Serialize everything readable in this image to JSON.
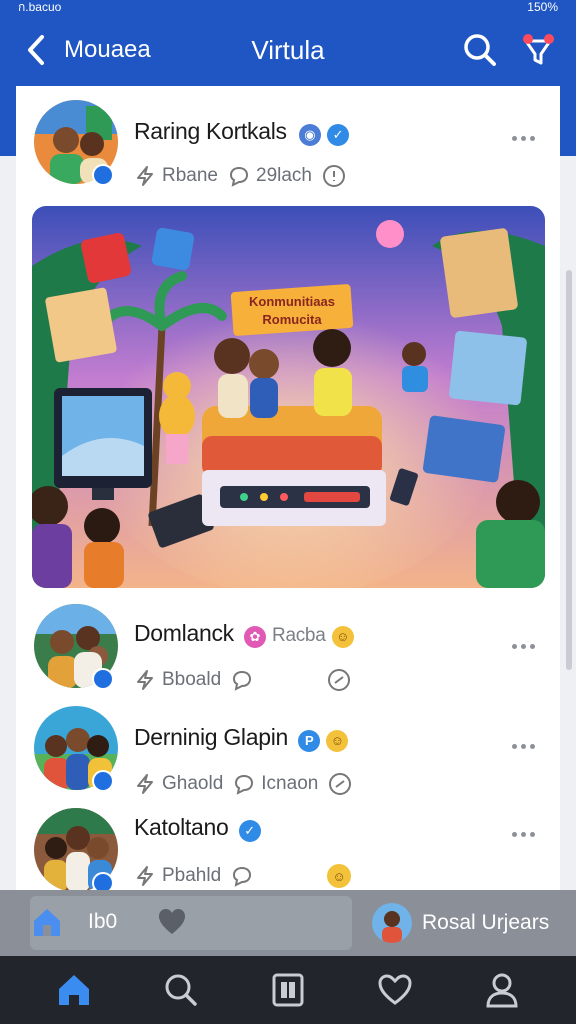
{
  "status_bar": {
    "left": "ก.bacuo",
    "right": "150%"
  },
  "top_bar": {
    "back_label": "Mouaea",
    "title": "Virtula",
    "accent": "#1f56c3"
  },
  "posts": [
    {
      "name": "Raring Kortkals",
      "meta": [
        "Rbane",
        "29lach"
      ],
      "avatar_colors": [
        "#e6733a",
        "#3f8fd8"
      ]
    },
    {
      "name": "Domlanck",
      "tag": "Racba",
      "meta": [
        "Bboald"
      ],
      "avatar_colors": [
        "#3b7d4a",
        "#e3a13a"
      ]
    },
    {
      "name": "Derninig Glapin",
      "meta": [
        "Ghaold",
        "Icnaon"
      ],
      "avatar_colors": [
        "#3aa6d8",
        "#e0543b"
      ]
    },
    {
      "name": "Katoltano",
      "meta": [
        "Pbahld"
      ],
      "avatar_colors": [
        "#8b5a3c",
        "#e2b23a"
      ]
    }
  ],
  "hero": {
    "banner_line1": "Konmunitiaas",
    "banner_line2": "Romucita"
  },
  "bottom_strip": {
    "label": "Ib0",
    "user_name": "Rosal Urjears"
  },
  "tab_bar": {
    "icons": [
      "home-icon",
      "search-icon",
      "library-icon",
      "heart-icon",
      "profile-icon"
    ],
    "active": "home-icon"
  }
}
